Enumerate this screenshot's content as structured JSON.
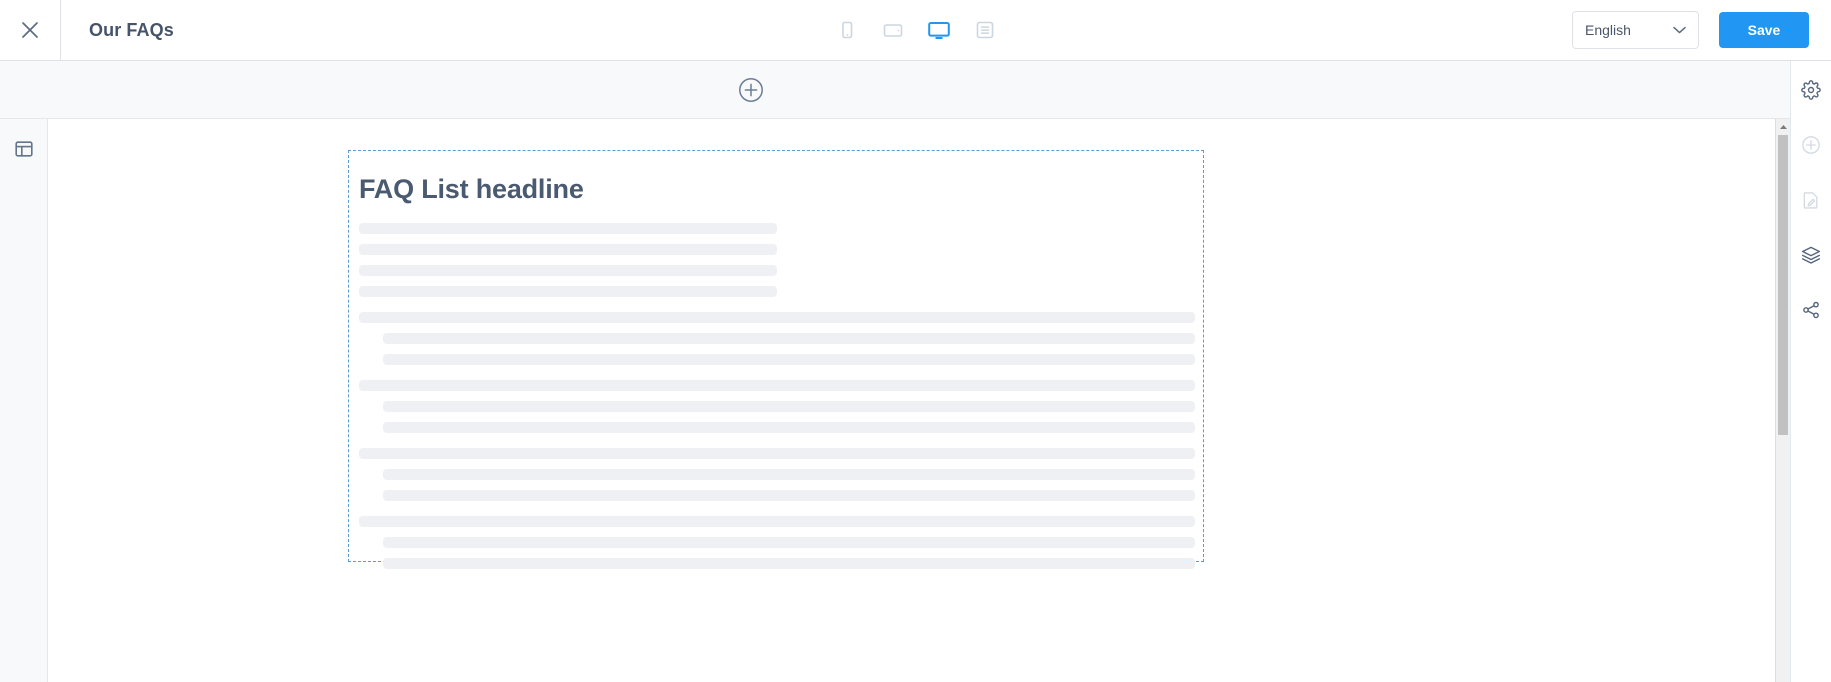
{
  "header": {
    "close_icon": "close-icon",
    "title": "Our FAQs",
    "devices": [
      {
        "name": "mobile-view",
        "icon": "mobile-icon",
        "active": false
      },
      {
        "name": "tablet-view",
        "icon": "tablet-icon",
        "active": false
      },
      {
        "name": "desktop-view",
        "icon": "desktop-icon",
        "active": true
      },
      {
        "name": "content-view",
        "icon": "article-icon",
        "active": false
      }
    ],
    "language": {
      "value": "English",
      "chevron_icon": "chevron-down-icon"
    },
    "save_label": "Save"
  },
  "toolbar": {
    "add_block_icon": "plus-circle-icon"
  },
  "left_rail": {
    "layout_icon": "layout-panel-icon"
  },
  "right_rail": {
    "items": [
      {
        "name": "settings",
        "icon": "gear-icon",
        "enabled": true
      },
      {
        "name": "add-element",
        "icon": "plus-circle-icon",
        "enabled": false
      },
      {
        "name": "edit-content",
        "icon": "edit-document-icon",
        "enabled": false
      },
      {
        "name": "layers",
        "icon": "layers-icon",
        "enabled": true
      },
      {
        "name": "share",
        "icon": "share-icon",
        "enabled": true
      }
    ]
  },
  "canvas": {
    "block": {
      "headline": "FAQ List headline",
      "selected": true,
      "intro_line_count": 4,
      "faq_groups": [
        {
          "answer_line_count": 2
        },
        {
          "answer_line_count": 2
        },
        {
          "answer_line_count": 2
        },
        {
          "answer_line_count": 2
        }
      ]
    }
  },
  "colors": {
    "accent": "#2196f3",
    "selection_border": "#5b9bd5",
    "skeleton": "#eef0f4",
    "text_dark": "#45546b",
    "icon_muted": "#ccd6e0",
    "icon_rail": "#55657d",
    "panel_bg": "#f7f9fb",
    "border": "#dfe3e8"
  },
  "scrollbar": {
    "arrow_up_icon": "caret-up-icon"
  }
}
